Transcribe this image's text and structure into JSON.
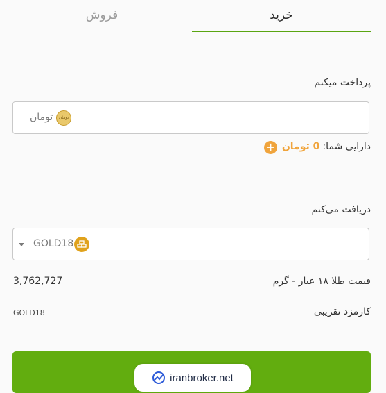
{
  "tabs": {
    "buy": "خرید",
    "sell": "فروش"
  },
  "pay": {
    "label": "پرداخت میکنم",
    "currency": "تومان",
    "coin_text": "تومان",
    "coin_icon": "toman-coin-icon"
  },
  "balance": {
    "prefix": "دارایی شما:",
    "amount": "0 تومان",
    "add_icon": "plus-icon"
  },
  "receive": {
    "label": "دریافت می‌کنم",
    "selected": "GOLD18",
    "coin_icon": "gold-bars-icon"
  },
  "price": {
    "label": "قیمت طلا ۱۸ عیار - گرم",
    "value": "3,762,727"
  },
  "fee": {
    "label": "کارمزد تقریبی",
    "value": "GOLD18"
  },
  "watermark": {
    "text": "iranbroker.net"
  },
  "colors": {
    "accent": "#5aa511",
    "button": "#62ad0f",
    "balance": "#f0a43c"
  }
}
